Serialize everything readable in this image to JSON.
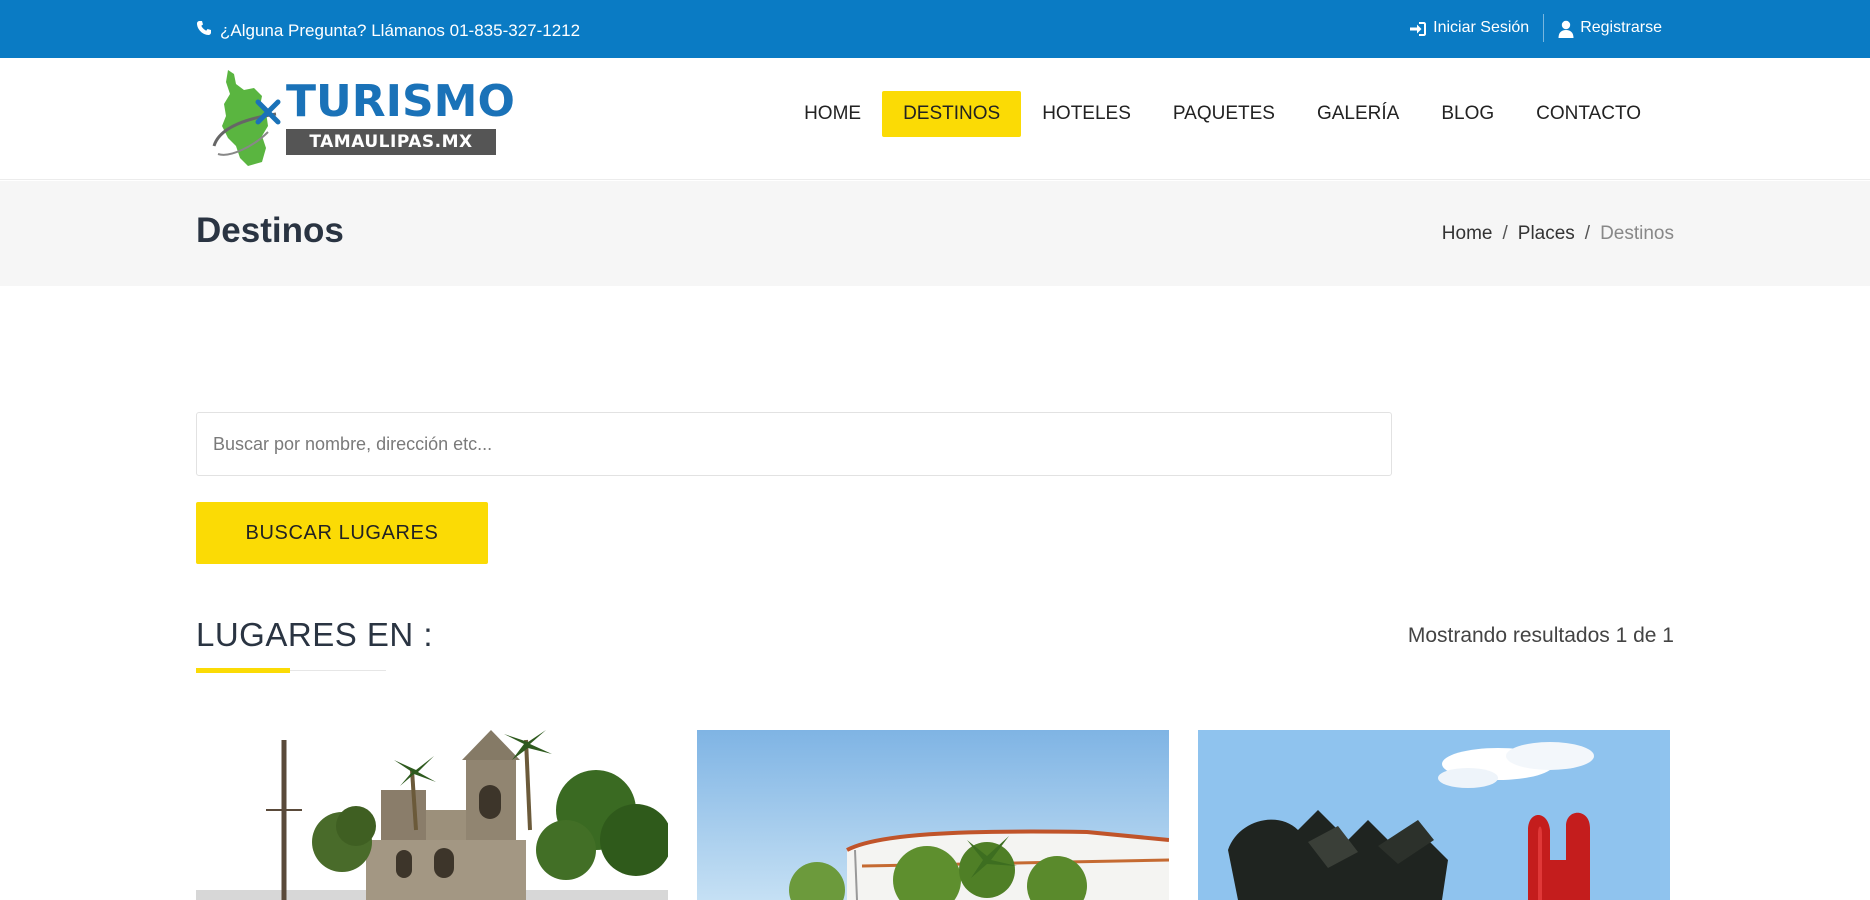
{
  "topbar": {
    "phone_text": "¿Alguna Pregunta? Llámanos 01-835-327-1212",
    "login_label": "Iniciar Sesión",
    "register_label": "Registrarse",
    "background_color": "#0a7bc4"
  },
  "logo": {
    "title": "TURISMO",
    "subtitle": "TAMAULIPAS.MX"
  },
  "nav": {
    "items": [
      {
        "label": "HOME"
      },
      {
        "label": "DESTINOS",
        "active": true
      },
      {
        "label": "HOTELES"
      },
      {
        "label": "PAQUETES"
      },
      {
        "label": "GALERÍA"
      },
      {
        "label": "BLOG"
      },
      {
        "label": "CONTACTO"
      }
    ],
    "active_color": "#fbdb05"
  },
  "page": {
    "title": "Destinos",
    "breadcrumb": [
      "Home",
      "Places",
      "Destinos"
    ]
  },
  "search": {
    "placeholder": "Buscar por nombre, dirección etc...",
    "value": "",
    "button_label": "BUSCAR LUGARES"
  },
  "listing": {
    "heading": "LUGARES EN :",
    "results_text": "Mostrando resultados 1 de 1",
    "cards": [
      {
        "image": "church-stone-palms-photo"
      },
      {
        "image": "modern-building-palms-photo"
      },
      {
        "image": "sculpture-red-arch-photo"
      }
    ]
  }
}
